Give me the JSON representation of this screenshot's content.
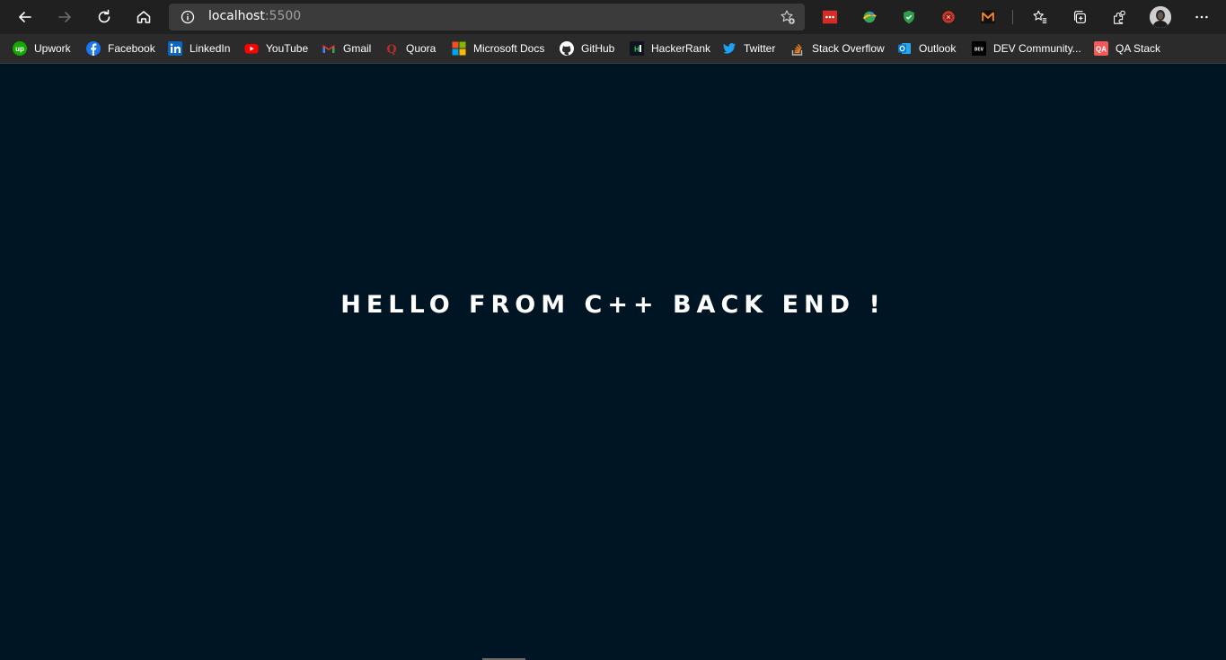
{
  "browser": {
    "address": {
      "host": "localhost",
      "port": ":5500"
    },
    "toolbar_icons": [
      "back-icon",
      "forward-icon",
      "refresh-icon",
      "home-icon",
      "info-icon",
      "add-favorite-icon",
      "favorites-icon",
      "collections-icon",
      "extensions-icon",
      "settings-more-icon"
    ],
    "extensions": [
      "lastpass-extension",
      "translate-extension",
      "shield-extension",
      "adblock-extension",
      "metamask-extension"
    ]
  },
  "bookmarks": [
    {
      "label": "Upwork",
      "icon": "upwork-icon",
      "color": "#14a800"
    },
    {
      "label": "Facebook",
      "icon": "facebook-icon",
      "color": "#1877f2"
    },
    {
      "label": "LinkedIn",
      "icon": "linkedin-icon",
      "color": "#0a66c2"
    },
    {
      "label": "YouTube",
      "icon": "youtube-icon",
      "color": "#ff0000"
    },
    {
      "label": "Gmail",
      "icon": "gmail-icon",
      "color": "#ea4335"
    },
    {
      "label": "Quora",
      "icon": "quora-icon",
      "color": "#b92b27"
    },
    {
      "label": "Microsoft Docs",
      "icon": "microsoft-icon",
      "color": "#f25022"
    },
    {
      "label": "GitHub",
      "icon": "github-icon",
      "color": "#ffffff"
    },
    {
      "label": "HackerRank",
      "icon": "hackerrank-icon",
      "color": "#2ec866"
    },
    {
      "label": "Twitter",
      "icon": "twitter-icon",
      "color": "#1da1f2"
    },
    {
      "label": "Stack Overflow",
      "icon": "stackoverflow-icon",
      "color": "#f48024"
    },
    {
      "label": "Outlook",
      "icon": "outlook-icon",
      "color": "#0078d4"
    },
    {
      "label": "DEV Community...",
      "icon": "dev-icon",
      "color": "#000000"
    },
    {
      "label": "QA Stack",
      "icon": "qastack-icon",
      "color": "#ef5a5a"
    }
  ],
  "page": {
    "heading": "HELLO FROM C++ BACK END !",
    "background": "#001524"
  }
}
